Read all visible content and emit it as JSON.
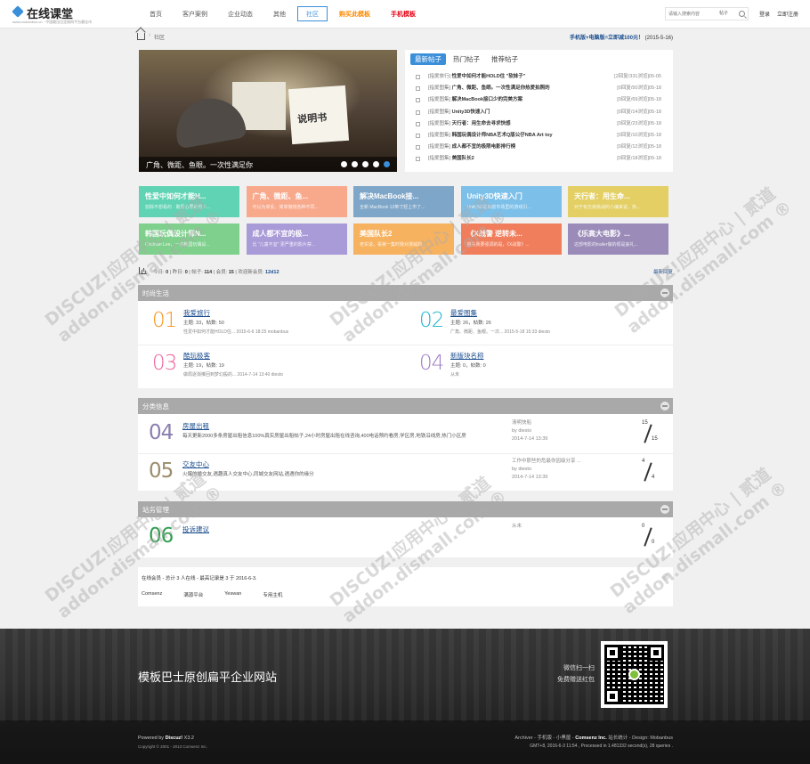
{
  "header": {
    "logo_text": "在线课堂",
    "logo_sub": "www.mobanbus.cn · 中国最出位定制网平台最佳市",
    "nav": [
      "首页",
      "客户案例",
      "企业动态",
      "其他",
      "社区",
      "购买此模板",
      "手机模板"
    ],
    "search_placeholder": "请输入搜索内容",
    "search_scope": "帖子",
    "login": "登录",
    "register": "立即注册"
  },
  "breadcrumb": {
    "current": "社区",
    "news_bold": "手机版+电脑版=立即减100元！",
    "news_date": "(2015-5-16)"
  },
  "slider": {
    "caption": "广角、微距、鱼眼。一次性满足你",
    "card_text": "说明书",
    "dots": 5,
    "active_dot": 4
  },
  "posts": {
    "tabs": [
      "最新帖子",
      "热门帖子",
      "推荐帖子"
    ],
    "items": [
      {
        "tag": "[指爱旅行]",
        "title": "性爱中如何才能HOLD住 \"软妹子\"",
        "meta": "[2回复/331浏览]",
        "date": "05-05"
      },
      {
        "tag": "[指爱图集]",
        "title": "广角、微距、鱼眼。一次性满足你热爱拍照的",
        "meta": "[0回复/50浏览]",
        "date": "05-18"
      },
      {
        "tag": "[指爱图集]",
        "title": "解决MacBook接口少的完美方案",
        "meta": "[0回复/69浏览]",
        "date": "05-18"
      },
      {
        "tag": "[指爱图集]",
        "title": "Unity3D快速入门",
        "meta": "[0回复/14浏览]",
        "date": "05-18"
      },
      {
        "tag": "[指爱图集]",
        "title": "天行者：用生命去寻求快感",
        "meta": "[0回复/23浏览]",
        "date": "05-18"
      },
      {
        "tag": "[指爱图集]",
        "title": "韩国玩偶设计师NBA艺术Q版公仔NBA Art toy",
        "meta": "[0回复/10浏览]",
        "date": "05-18"
      },
      {
        "tag": "[指爱图集]",
        "title": "成人都不宜的极限电影排行榜",
        "meta": "[0回复/12浏览]",
        "date": "05-18"
      },
      {
        "tag": "[指爱图集]",
        "title": "美国队长2",
        "meta": "[0回复/18浏览]",
        "date": "05-18"
      }
    ]
  },
  "tiles": [
    {
      "title": "性爱中如何才能H...",
      "desc": "割除不想看的 · 敢厨心要的男人...",
      "color": "#5fd3b3"
    },
    {
      "title": "广角、微距、鱼...",
      "desc": "可以为单反、简单微镜各种不同...",
      "color": "#f8a98c"
    },
    {
      "title": "解决MacBook接...",
      "desc": "全新 MacBook 12英寸轻上市了...",
      "color": "#7ea6c9"
    },
    {
      "title": "Unity3D快速入门",
      "desc": "Unity3D是目前市场里的游戏引...",
      "color": "#7cbfe8"
    },
    {
      "title": "天行者：用生命...",
      "desc": "对于有志疾挑战的小编来说，热...",
      "color": "#e3cf63"
    },
    {
      "title": "韩国玩偶设计师N...",
      "desc": "Coolrain Lee，一名韩国玩偶设...",
      "color": "#7ed08c"
    },
    {
      "title": "成人都不宜的极...",
      "desc": "比 \"儿童不宜\" 更严重的影片禁...",
      "color": "#a99ad8"
    },
    {
      "title": "美国队长2",
      "desc": "老实说，看第一集时我对漫威的...",
      "color": "#f7b260"
    },
    {
      "title": "《X战警 逆转未...",
      "desc": "首先我要强调的是，《X战警》...",
      "color": "#f07e5c"
    },
    {
      "title": "《乐高大电影》...",
      "desc": "这部电影的trailer做的很是妄礼...",
      "color": "#9a8bb8"
    }
  ],
  "stats": {
    "today_label": "今日:",
    "today": "0",
    "yesterday_label": "昨日:",
    "yesterday": "0",
    "posts_label": "帖子:",
    "posts": "114",
    "members_label": "会员:",
    "members": "15",
    "welcome_label": "欢迎新会员:",
    "newest": "12d12",
    "latest": "最新回复"
  },
  "section1": {
    "title": "时尚生活",
    "forums": [
      {
        "num": "01",
        "color": "#f7931e",
        "name": "我爱旅行",
        "info": "主题: 33，帖数: 50",
        "last": "性爱中如何才能HOLD住...   2015-6-6 18:25 mobanbus"
      },
      {
        "num": "02",
        "color": "#1fb3cf",
        "name": "最爱图集",
        "info": "主题: 26，帖数: 26",
        "last": "广角、微距、鱼眼。一次...   2015-5-18 15:33 diesto"
      },
      {
        "num": "03",
        "color": "#ee5f9a",
        "name": "酷玩极客",
        "info": "主题: 19，帖数: 19",
        "last": "做局逐渐推回到梦幻般的...   2014-7-14 13:40 diesto"
      },
      {
        "num": "04",
        "color": "#a07cc4",
        "name": "新版块名称",
        "info": "主题: 0，帖数: 0",
        "last": "从未"
      }
    ]
  },
  "section2": {
    "title": "分类信息",
    "rows": [
      {
        "num": "04",
        "color": "#8a7fb0",
        "name": "房屋出租",
        "desc": "每天更新2000多条房屋出租信息100%真实房屋出租帖子,24小时房屋出租在线咨询,400电话预约看房,学区房,地铁沿线房,热门小区房",
        "last1": "清明快船",
        "last2": "by diesto",
        "last3": "2014-7-14 13:39",
        "a": "15",
        "b": "15"
      },
      {
        "num": "05",
        "color": "#9b8c6c",
        "name": "交友中心",
        "desc": "火爆的婚交友,遇趣真人交友中心,同城交友网站,遇遇你的缘分",
        "last1": "工作中那些的危最你因级分享 ...",
        "last2": "by diesto",
        "last3": "2014-7-14 13:39",
        "a": "4",
        "b": "4"
      }
    ]
  },
  "section3": {
    "title": "站务管理",
    "rows": [
      {
        "num": "06",
        "color": "#2f9e4f",
        "name": "投诉建议",
        "last1": "从未",
        "a": "0",
        "b": "0"
      }
    ]
  },
  "online": {
    "title": "在线会员 - 总计 3 人在线 - 最高记录是 3 于 2016-6-3.",
    "members": [
      "Comsenz",
      "满源平台",
      "Yeswan",
      "专用主机"
    ]
  },
  "watermark": {
    "line1": "DISCUZ!应用中心 | 贰道",
    "line2": "addon.dismall.com ®"
  },
  "footer": {
    "slogan": "模板巴士原创扁平企业网站",
    "qr_line1": "微信扫一扫",
    "qr_line2": "免费赠送红包",
    "powered_prefix": "Powered by",
    "powered_name": "Discuz!",
    "powered_ver": "X3.2",
    "copyright": "Copyright © 2001 - 2013 Comsenz Inc.",
    "links": "Archiver - 手机版 - 小黑屋 -",
    "links_bold": "Comsenz Inc.",
    "links_tail": "站长统计 - Design: Mobanbus",
    "gmt": "GMT+8, 2016-6-3 11:54 , Processed in 1.481332 second(s), 28 queries ."
  }
}
